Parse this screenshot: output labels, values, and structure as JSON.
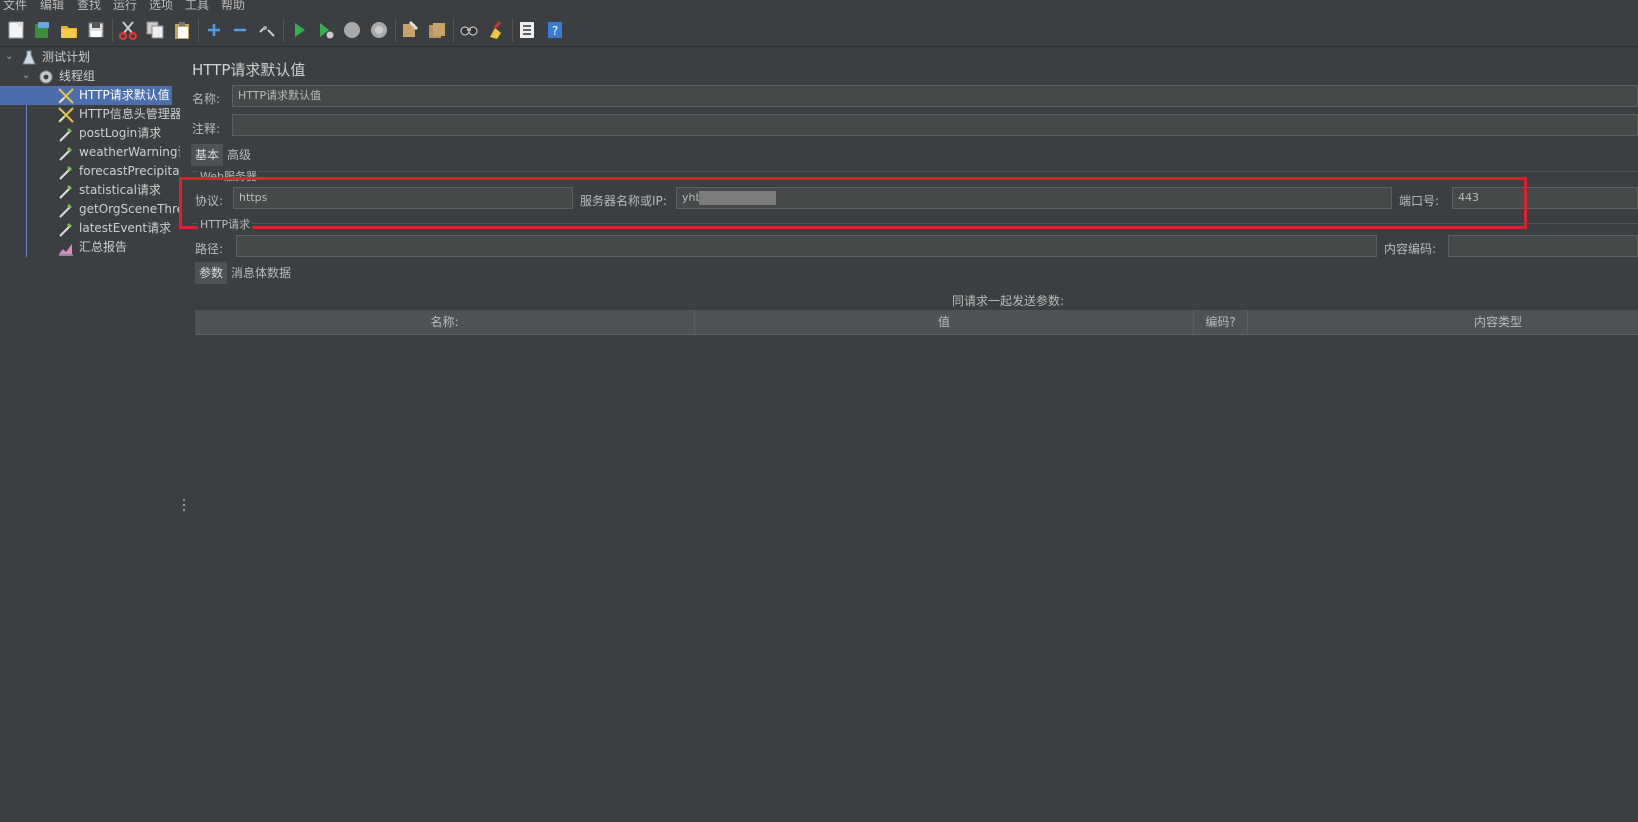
{
  "menu": [
    "文件",
    "编辑",
    "查找",
    "运行",
    "选项",
    "工具",
    "帮助"
  ],
  "toolbar_icons": [
    "new-icon",
    "templates-icon",
    "open-icon",
    "save-icon",
    "cut-icon",
    "copy-icon",
    "paste-icon",
    "expand-icon",
    "collapse-icon",
    "toggle-icon",
    "start-icon",
    "start-no-pause-icon",
    "stop-icon",
    "shutdown-icon",
    "clear-icon",
    "clear-all-icon",
    "search-icon",
    "reset-search-icon",
    "function-helper-icon",
    "help-icon"
  ],
  "tree": {
    "root": "测试计划",
    "thread_group": "线程组",
    "items": [
      {
        "label": "HTTP请求默认值",
        "icon": "config-icon",
        "selected": true
      },
      {
        "label": "HTTP信息头管理器",
        "icon": "config-icon"
      },
      {
        "label": "postLogin请求",
        "icon": "sampler-icon"
      },
      {
        "label": "weatherWarning请",
        "icon": "sampler-icon"
      },
      {
        "label": "forecastPrecipitatio",
        "icon": "sampler-icon"
      },
      {
        "label": "statistical请求",
        "icon": "sampler-icon"
      },
      {
        "label": "getOrgSceneThree",
        "icon": "sampler-icon"
      },
      {
        "label": "latestEvent请求",
        "icon": "sampler-icon"
      },
      {
        "label": "汇总报告",
        "icon": "report-icon"
      }
    ]
  },
  "panel": {
    "title": "HTTP请求默认值",
    "name_label": "名称:",
    "name_value": "HTTP请求默认值",
    "comment_label": "注释:",
    "comment_value": "",
    "tabs": {
      "basic": "基本",
      "advanced": "高级"
    },
    "web_server_group": "Web服务器",
    "protocol_label": "协议:",
    "protocol_value": "https",
    "server_label": "服务器名称或IP:",
    "server_value": "yhb",
    "port_label": "端口号:",
    "port_value": "443",
    "http_request_group": "HTTP请求",
    "path_label": "路径:",
    "path_value": "",
    "encoding_label": "内容编码:",
    "encoding_value": "",
    "sub_tabs": {
      "params": "参数",
      "body": "消息体数据"
    },
    "params_caption": "同请求一起发送参数:",
    "columns": [
      "名称:",
      "值",
      "编码?",
      "内容类型"
    ]
  },
  "colors": {
    "background": "#3c3f41",
    "selection": "#4b6eaf",
    "highlight": "#e0202b"
  }
}
